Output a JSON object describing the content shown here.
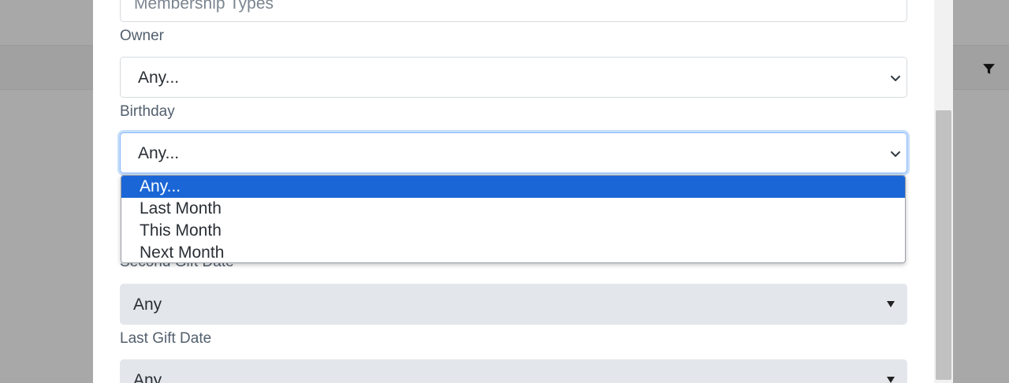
{
  "fields": {
    "membership_types_placeholder": "Membership Types",
    "owner_label": "Owner",
    "owner_value": "Any...",
    "birthday_label": "Birthday",
    "birthday_value": "Any...",
    "second_gift_label": "Second Gift Date",
    "second_gift_value": "Any",
    "last_gift_label": "Last Gift Date",
    "last_gift_value": "Any"
  },
  "birthday_dropdown": {
    "options": [
      "Any...",
      "Last Month",
      "This Month",
      "Next Month"
    ],
    "selected_index": 0
  },
  "icons": {
    "filter": "filter-icon",
    "chevron": "chevron-down-icon",
    "caret": "caret-down-icon"
  },
  "colors": {
    "focus_border": "#86b7fe",
    "option_selected": "#1a66d6",
    "backdrop": "#a8a8a8"
  }
}
